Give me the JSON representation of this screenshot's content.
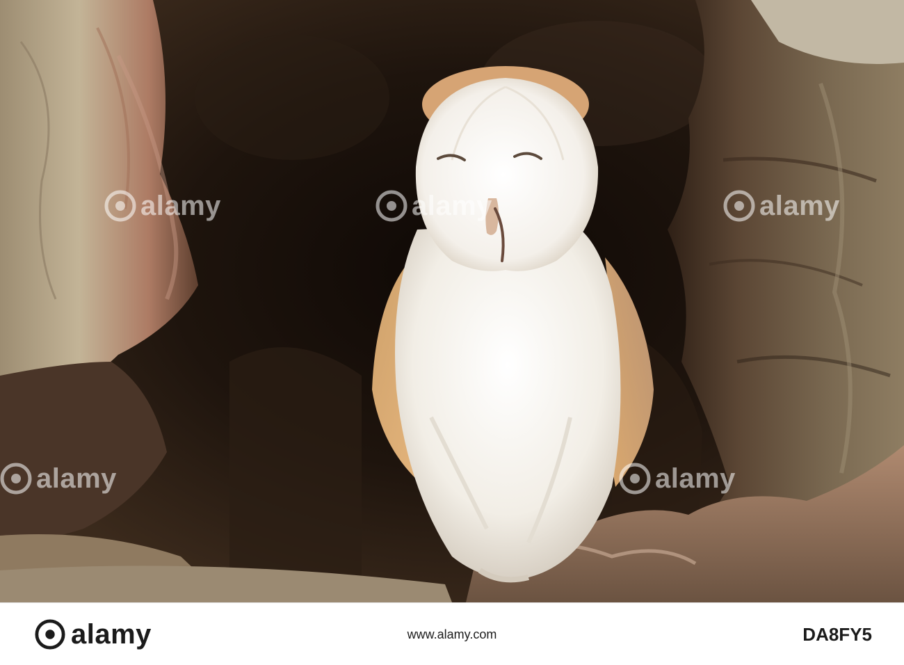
{
  "photo": {
    "subject": "barn-owl-in-tree-hollow",
    "colors": {
      "hollow_dark": "#1a110b",
      "bark_light": "#b9a78c",
      "bark_rust": "#a5705a",
      "owl_white": "#f7f4ee",
      "owl_buff": "#d9a46a"
    }
  },
  "watermark": {
    "text": "alamy"
  },
  "footer": {
    "logo_text": "alamy",
    "link_text": "www.alamy.com",
    "image_id": "DA8FY5"
  }
}
